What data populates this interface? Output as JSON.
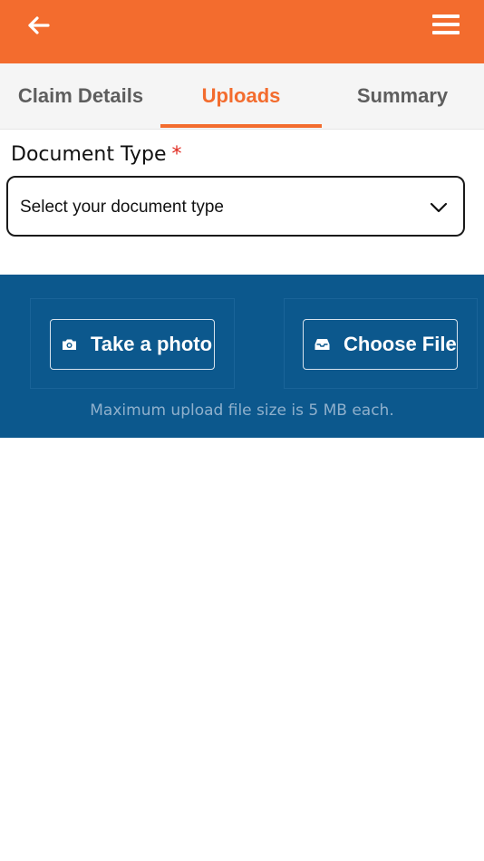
{
  "header": {
    "back_icon": "arrow-left-icon",
    "menu_icon": "hamburger-menu-icon",
    "background_color": "#F36C2E"
  },
  "tabs": [
    {
      "label": "Claim Details",
      "active": false
    },
    {
      "label": "Uploads",
      "active": true
    },
    {
      "label": "Summary",
      "active": false
    }
  ],
  "form": {
    "document_type_label": "Document Type",
    "required_marker": "*",
    "document_type_placeholder": "Select your document type",
    "dropdown_icon": "chevron-down-icon"
  },
  "upload": {
    "take_photo_label": "Take a photo",
    "take_photo_icon": "camera-icon",
    "choose_file_label": "Choose File",
    "choose_file_icon": "inbox-icon",
    "hint": "Maximum upload file size is 5 MB each.",
    "panel_color": "#0C588D"
  }
}
